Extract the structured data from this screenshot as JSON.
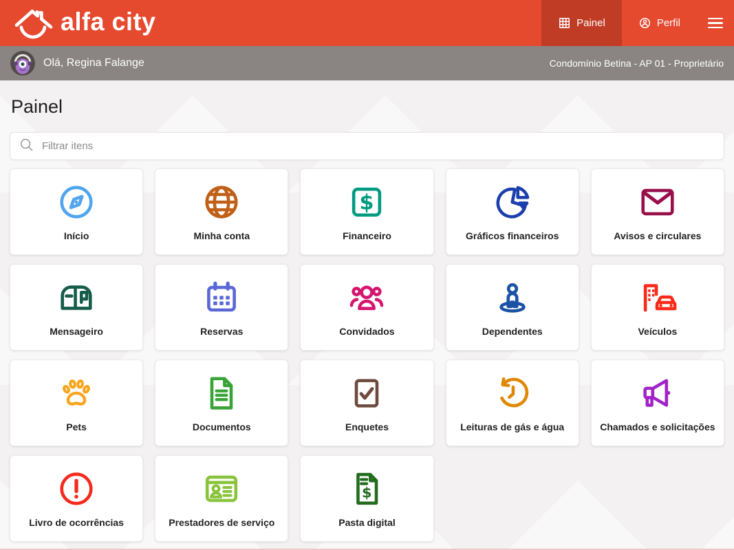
{
  "header": {
    "brand": "alfa city",
    "nav": [
      {
        "label": "Painel",
        "icon": "grid-icon",
        "active": true
      },
      {
        "label": "Perfil",
        "icon": "person-circle-icon",
        "active": false
      }
    ],
    "menu_icon": "hamburger-icon"
  },
  "subheader": {
    "greeting": "Olá, Regina Falange",
    "context": "Condomínio Betina - AP 01 - Proprietário"
  },
  "page": {
    "title": "Painel"
  },
  "search": {
    "placeholder": "Filtrar itens",
    "icon": "search-icon"
  },
  "cards": [
    {
      "label": "Início",
      "icon": "compass-icon",
      "color": "#4fa5ee"
    },
    {
      "label": "Minha conta",
      "icon": "globe-icon",
      "color": "#c06018"
    },
    {
      "label": "Financeiro",
      "icon": "dollar-square-icon",
      "color": "#009b80"
    },
    {
      "label": "Gráficos financeiros",
      "icon": "pie-chart-icon",
      "color": "#1c3fae"
    },
    {
      "label": "Avisos e circulares",
      "icon": "envelope-icon",
      "color": "#98104b"
    },
    {
      "label": "Mensageiro",
      "icon": "mailbox-icon",
      "color": "#155c49"
    },
    {
      "label": "Reservas",
      "icon": "calendar-icon",
      "color": "#5a68d6"
    },
    {
      "label": "Convidados",
      "icon": "people-group-icon",
      "color": "#d6156f"
    },
    {
      "label": "Dependentes",
      "icon": "person-location-icon",
      "color": "#1b52a4"
    },
    {
      "label": "Veículos",
      "icon": "building-car-icon",
      "color": "#fa2a1a"
    },
    {
      "label": "Pets",
      "icon": "paw-icon",
      "color": "#f7a51c"
    },
    {
      "label": "Documentos",
      "icon": "document-icon",
      "color": "#38a336"
    },
    {
      "label": "Enquetes",
      "icon": "checkbox-icon",
      "color": "#6d4a3d"
    },
    {
      "label": "Leituras de gás e água",
      "icon": "history-clock-icon",
      "color": "#df8800"
    },
    {
      "label": "Chamados e solicitações",
      "icon": "megaphone-icon",
      "color": "#a322c8"
    },
    {
      "label": "Livro de ocorrências",
      "icon": "alert-circle-icon",
      "color": "#f52a1d"
    },
    {
      "label": "Prestadores de serviço",
      "icon": "id-card-icon",
      "color": "#8ac43d"
    },
    {
      "label": "Pasta digital",
      "icon": "invoice-dollar-icon",
      "color": "#236c1e"
    }
  ],
  "colors": {
    "header_bg": "#e5492e",
    "active_tab_bg": "#c03c25",
    "subheader_bg": "#8a8583",
    "page_bg": "#f3f1f1",
    "footer_line": "#edc9c5"
  }
}
